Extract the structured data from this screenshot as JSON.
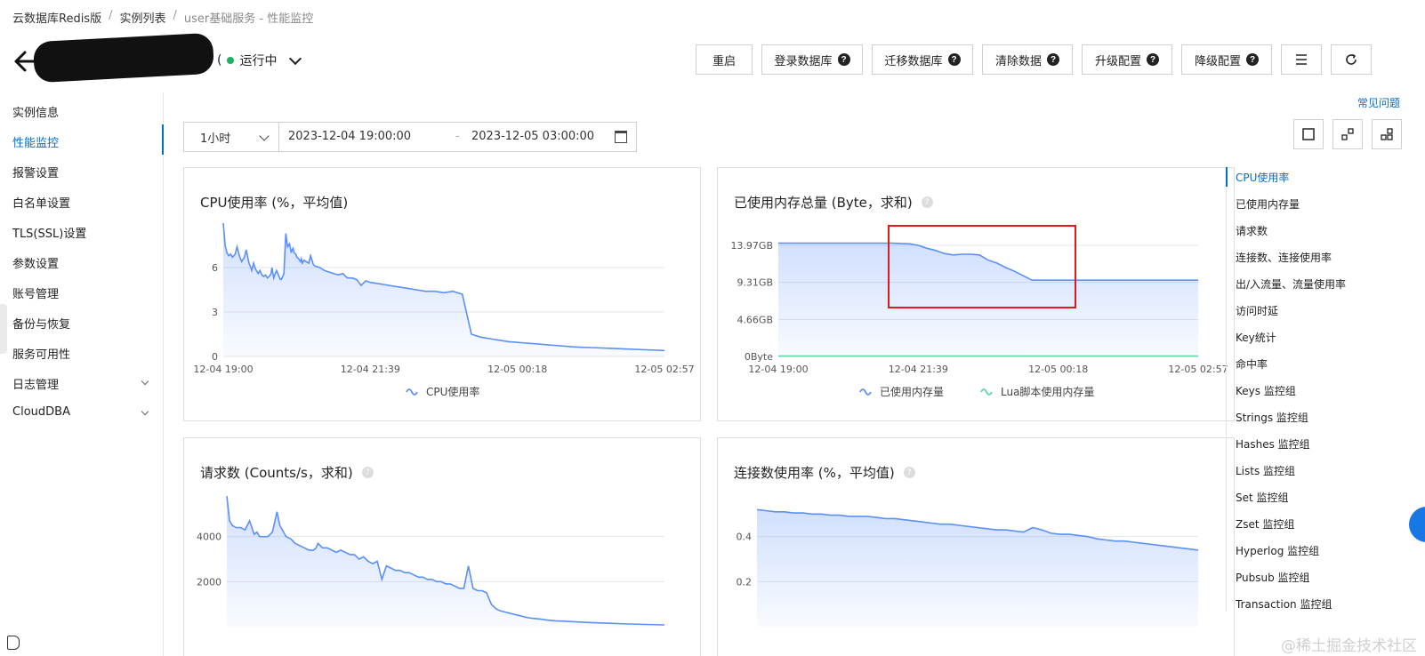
{
  "breadcrumb": [
    "云数据库Redis版",
    "实例列表",
    "user基础服务 - 性能监控"
  ],
  "status": {
    "label": "运行中",
    "color": "#19b35f"
  },
  "toolbar": [
    {
      "label": "重启",
      "help": false
    },
    {
      "label": "登录数据库",
      "help": true
    },
    {
      "label": "迁移数据库",
      "help": true
    },
    {
      "label": "清除数据",
      "help": true
    },
    {
      "label": "升级配置",
      "help": true
    },
    {
      "label": "降级配置",
      "help": true
    }
  ],
  "icons": {
    "menu": "menu-icon",
    "refresh": "refresh-icon"
  },
  "faq": "常见问题",
  "sidebar": [
    {
      "label": "实例信息"
    },
    {
      "label": "性能监控",
      "active": true
    },
    {
      "label": "报警设置"
    },
    {
      "label": "白名单设置"
    },
    {
      "label": "TLS(SSL)设置"
    },
    {
      "label": "参数设置"
    },
    {
      "label": "账号管理"
    },
    {
      "label": "备份与恢复"
    },
    {
      "label": "服务可用性"
    },
    {
      "label": "日志管理",
      "expandable": true
    },
    {
      "label": "CloudDBA",
      "expandable": true
    }
  ],
  "timebar": {
    "interval": "1小时",
    "start": "2023-12-04 19:00:00",
    "dash": "-",
    "end": "2023-12-05 03:00:00"
  },
  "anchors": [
    "CPU使用率",
    "已使用内存量",
    "请求数",
    "连接数、连接使用率",
    "出/入流量、流量使用率",
    "访问时延",
    "Key统计",
    "命中率",
    "Keys 监控组",
    "Strings 监控组",
    "Hashes 监控组",
    "Lists 监控组",
    "Set 监控组",
    "Zset 监控组",
    "Hyperlog 监控组",
    "Pubsub 监控组",
    "Transaction 监控组"
  ],
  "watermark": "@稀土掘金技术社区",
  "chart_data": [
    {
      "type": "area",
      "title": "CPU使用率 (%，平均值)",
      "help": false,
      "x_ticks": [
        "12-04 19:00",
        "12-04 21:39",
        "12-05 00:18",
        "12-05 02:57"
      ],
      "y_ticks": [
        "0",
        "3",
        "6"
      ],
      "ylim": [
        0,
        9
      ],
      "series": [
        {
          "name": "CPU使用率",
          "color": "#5b8ff9",
          "x": [
            0,
            4,
            8,
            12,
            16,
            20,
            26,
            30,
            36,
            40,
            46,
            50,
            56,
            60,
            62,
            66,
            70,
            76,
            80,
            84,
            88,
            92,
            96,
            100,
            104,
            106,
            108,
            110,
            112,
            116,
            120,
            124,
            126,
            128,
            132,
            136,
            140,
            144,
            148,
            150,
            152,
            154,
            158,
            160,
            164,
            168,
            170,
            172,
            176,
            180,
            186,
            190,
            196,
            200,
            210,
            220,
            230,
            240,
            250,
            260,
            270,
            280,
            290,
            300,
            310,
            320,
            340,
            360,
            380,
            400,
            420,
            440,
            460,
            480,
            500,
            520,
            540,
            560,
            580,
            600,
            620,
            640,
            660,
            680,
            700,
            720,
            740,
            760,
            780,
            800,
            840,
            880,
            920,
            960
          ],
          "y": [
            9.0,
            7.5,
            7.0,
            6.8,
            6.9,
            6.7,
            6.9,
            7.4,
            6.7,
            6.4,
            6.7,
            7.2,
            6.3,
            6.0,
            5.8,
            6.3,
            5.9,
            5.6,
            5.8,
            5.5,
            5.4,
            5.5,
            5.3,
            5.4,
            5.6,
            6.0,
            5.6,
            5.3,
            5.5,
            5.8,
            5.5,
            5.2,
            5.2,
            5.3,
            5.6,
            8.3,
            7.4,
            7.6,
            7.0,
            7.2,
            7.3,
            7.0,
            6.9,
            6.7,
            6.6,
            6.4,
            6.6,
            6.3,
            6.5,
            6.4,
            6.3,
            6.8,
            6.2,
            6.1,
            6.0,
            5.8,
            5.7,
            5.6,
            5.5,
            5.6,
            5.3,
            5.3,
            5.2,
            4.8,
            5.1,
            5.0,
            4.9,
            4.8,
            4.7,
            4.6,
            4.5,
            4.4,
            4.4,
            4.3,
            4.4,
            4.2,
            1.5,
            1.3,
            1.2,
            1.1,
            1.0,
            0.95,
            0.9,
            0.85,
            0.8,
            0.75,
            0.7,
            0.65,
            0.62,
            0.6,
            0.55,
            0.5,
            0.45,
            0.4
          ]
        }
      ]
    },
    {
      "type": "area",
      "title": "已使用内存总量 (Byte，求和)",
      "help": true,
      "x_ticks": [
        "12-04 19:00",
        "12-04 21:39",
        "12-05 00:18",
        "12-05 02:57"
      ],
      "y_ticks": [
        "0Byte",
        "4.66GB",
        "9.31GB",
        "13.97GB"
      ],
      "ylim": [
        0,
        18
      ],
      "series": [
        {
          "name": "已使用内存量",
          "color": "#5b8ff9",
          "x": [
            0,
            20,
            40,
            60,
            80,
            100,
            120,
            140,
            160,
            180,
            200,
            220,
            240,
            260,
            280,
            300,
            320,
            340,
            360,
            380,
            400,
            420,
            440,
            460,
            480,
            500,
            520,
            540,
            560,
            580,
            600,
            620,
            640,
            660,
            680,
            700,
            720,
            740,
            760,
            780,
            800,
            820,
            840,
            860,
            880,
            900,
            920,
            940,
            960
          ],
          "y": [
            15.3,
            15.3,
            15.3,
            15.3,
            15.3,
            15.3,
            15.3,
            15.3,
            15.3,
            15.3,
            15.3,
            15.3,
            15.3,
            15.3,
            15.25,
            15.2,
            15.0,
            14.6,
            14.3,
            13.9,
            13.7,
            13.8,
            13.8,
            13.7,
            13.0,
            12.6,
            12.0,
            11.5,
            10.9,
            10.3,
            10.3,
            10.3,
            10.3,
            10.3,
            10.3,
            10.3,
            10.3,
            10.3,
            10.3,
            10.3,
            10.3,
            10.3,
            10.3,
            10.3,
            10.3,
            10.3,
            10.3,
            10.3,
            10.3
          ]
        },
        {
          "name": "Lua脚本使用内存量",
          "color": "#5ad8a6",
          "x": [
            0,
            960
          ],
          "y": [
            0.05,
            0.05
          ]
        }
      ]
    },
    {
      "type": "area",
      "title": "请求数 (Counts/s，求和)",
      "help": true,
      "x_ticks": [],
      "y_ticks": [
        "2000",
        "4000"
      ],
      "ylim": [
        0,
        6000
      ],
      "series": [
        {
          "name": "请求数",
          "color": "#5b8ff9",
          "x": [
            0,
            6,
            12,
            20,
            30,
            40,
            50,
            60,
            66,
            72,
            80,
            90,
            100,
            110,
            116,
            122,
            130,
            140,
            150,
            160,
            170,
            180,
            190,
            196,
            200,
            210,
            220,
            230,
            240,
            250,
            260,
            270,
            280,
            290,
            300,
            310,
            320,
            330,
            340,
            350,
            360,
            370,
            380,
            390,
            400,
            410,
            420,
            430,
            440,
            450,
            460,
            470,
            480,
            490,
            500,
            510,
            520,
            530,
            540,
            550,
            560,
            570,
            580,
            590,
            600,
            610,
            620,
            630,
            640,
            650,
            660,
            670,
            680,
            690,
            700,
            710,
            720,
            760,
            800,
            840,
            880,
            920,
            960
          ],
          "y": [
            5800,
            4700,
            4500,
            4400,
            4400,
            4300,
            4700,
            4100,
            4200,
            4000,
            4000,
            4000,
            4200,
            5100,
            4500,
            4300,
            4000,
            3900,
            3700,
            3600,
            3500,
            3400,
            3400,
            3500,
            3700,
            3500,
            3500,
            3400,
            3300,
            3400,
            3300,
            3200,
            3200,
            3000,
            3100,
            2900,
            2800,
            2900,
            2100,
            2700,
            2600,
            2500,
            2500,
            2400,
            2400,
            2300,
            2200,
            2200,
            2100,
            2100,
            2000,
            2000,
            1900,
            1900,
            1800,
            1700,
            1700,
            2700,
            1700,
            1600,
            1600,
            1500,
            1000,
            800,
            700,
            650,
            600,
            550,
            500,
            450,
            400,
            370,
            350,
            330,
            300,
            280,
            260,
            220,
            180,
            150,
            120,
            100,
            80
          ]
        }
      ]
    },
    {
      "type": "area",
      "title": "连接数使用率 (%，平均值)",
      "help": true,
      "x_ticks": [],
      "y_ticks": [
        "0.2",
        "0.4"
      ],
      "ylim": [
        0,
        0.6
      ],
      "series": [
        {
          "name": "连接数使用率",
          "color": "#5b8ff9",
          "x": [
            0,
            20,
            40,
            60,
            80,
            100,
            120,
            140,
            160,
            180,
            200,
            220,
            240,
            260,
            280,
            300,
            320,
            340,
            360,
            380,
            400,
            420,
            440,
            460,
            480,
            500,
            520,
            540,
            560,
            580,
            600,
            620,
            640,
            660,
            680,
            700,
            720,
            740,
            760,
            780,
            800,
            820,
            840,
            860,
            880,
            900,
            920,
            940,
            960
          ],
          "y": [
            0.52,
            0.515,
            0.51,
            0.51,
            0.505,
            0.505,
            0.5,
            0.5,
            0.495,
            0.495,
            0.49,
            0.49,
            0.49,
            0.485,
            0.48,
            0.48,
            0.475,
            0.47,
            0.465,
            0.46,
            0.455,
            0.455,
            0.45,
            0.445,
            0.44,
            0.435,
            0.43,
            0.43,
            0.425,
            0.42,
            0.44,
            0.43,
            0.415,
            0.41,
            0.41,
            0.405,
            0.4,
            0.39,
            0.385,
            0.38,
            0.38,
            0.375,
            0.37,
            0.365,
            0.36,
            0.355,
            0.35,
            0.345,
            0.34
          ]
        }
      ]
    }
  ]
}
